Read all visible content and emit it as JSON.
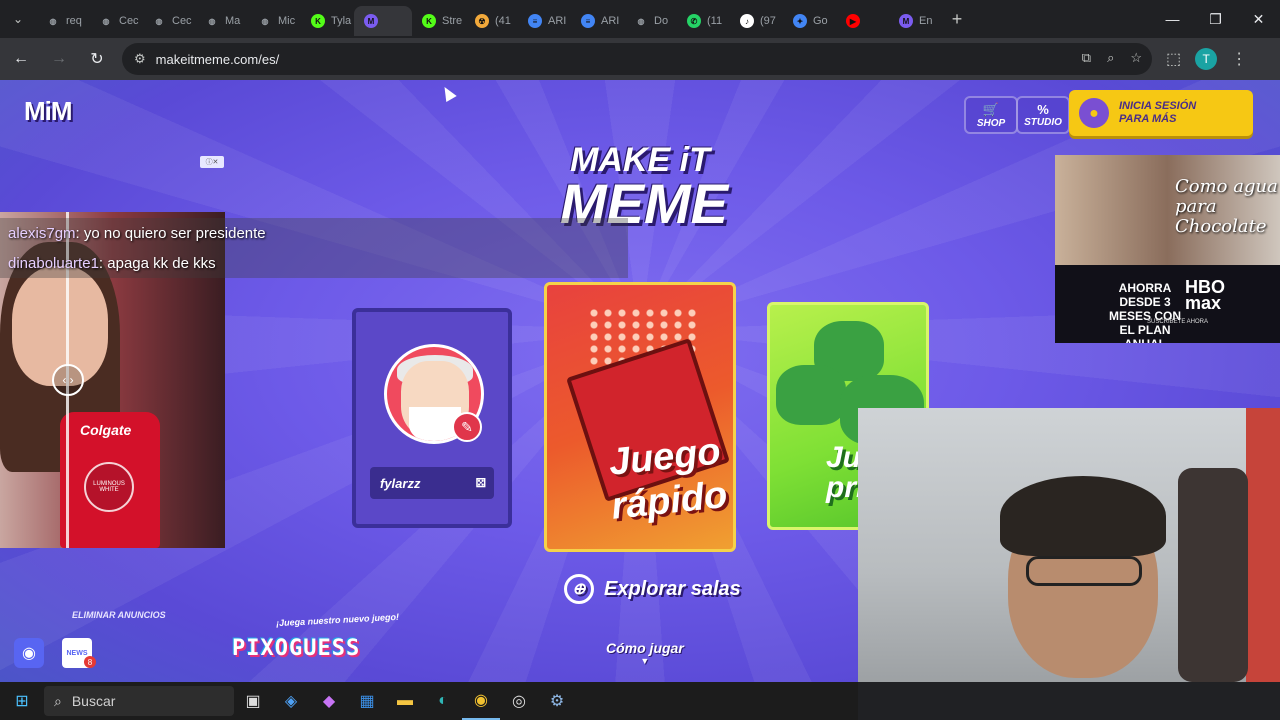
{
  "browser": {
    "tabs": [
      {
        "label": "req",
        "icon": "globe-icon",
        "color": "#9aa0a6"
      },
      {
        "label": "Cec",
        "icon": "globe-icon",
        "color": "#9aa0a6"
      },
      {
        "label": "Cec",
        "icon": "globe-icon",
        "color": "#9aa0a6"
      },
      {
        "label": "Ma",
        "icon": "globe-icon",
        "color": "#9aa0a6"
      },
      {
        "label": "Mic",
        "icon": "globe-icon",
        "color": "#9aa0a6"
      },
      {
        "label": "Tyla",
        "icon": "k-icon",
        "color": "#53fc18"
      },
      {
        "label": "",
        "icon": "mim-icon",
        "color": "#7b5cf0",
        "active": true
      },
      {
        "label": "Stre",
        "icon": "k-icon",
        "color": "#53fc18"
      },
      {
        "label": "(41",
        "icon": "bolt-icon",
        "color": "#f2a93b"
      },
      {
        "label": "ARI",
        "icon": "doc-icon",
        "color": "#4285f4"
      },
      {
        "label": "ARI",
        "icon": "doc-icon",
        "color": "#4285f4"
      },
      {
        "label": "Do",
        "icon": "globe-icon",
        "color": "#9aa0a6"
      },
      {
        "label": "(11",
        "icon": "whatsapp-icon",
        "color": "#25d366"
      },
      {
        "label": "(97",
        "icon": "tiktok-icon",
        "color": "#ffffff"
      },
      {
        "label": "Go",
        "icon": "gemini-icon",
        "color": "#4285f4"
      },
      {
        "label": "",
        "icon": "youtube-icon",
        "color": "#ff0000"
      },
      {
        "label": "En",
        "icon": "mim-icon",
        "color": "#7b5cf0"
      }
    ],
    "url": "makeitmeme.com/es/"
  },
  "site": {
    "logo_small": "MiM",
    "shop_label": "SHOP",
    "studio_label": "STUDIO",
    "login_line1": "INICIA SESIÓN",
    "login_line2": "PARA MÁS",
    "title_line1": "MAKE iT",
    "title_line2": "MEME",
    "profile_nick": "fylarzz",
    "quick_play_line1": "Juego",
    "quick_play_line2": "rápido",
    "private_line1": "Ju",
    "private_line2": "priv",
    "explore_label": "Explorar salas",
    "howto_label": "Cómo jugar",
    "remove_ads_label": "ELIMINAR ANUNCIOS",
    "news_label": "NEWS",
    "news_count": "8",
    "new_game_note": "¡Juega nuestro nuevo juego!",
    "pixoguess": "PIXOGUESS"
  },
  "chat": [
    {
      "user": "alexis7gm",
      "message": ": yo no quiero ser presidente"
    },
    {
      "user": "dinaboluarte1",
      "message": ": apaga kk de kks"
    }
  ],
  "ads": {
    "left_brand": "Colgate",
    "left_product": "LUMINOUS WHITE",
    "right_title": "Como agua para Chocolate",
    "right_offer": "AHORRA DESDE 3 MESES CON EL PLAN ANUAL",
    "right_brand": "HBO max",
    "right_cta": "SUSCRÍBETE AHORA"
  },
  "taskbar": {
    "search_placeholder": "Buscar"
  },
  "colors": {
    "accent_yellow": "#f6c814",
    "bg_purple": "#6d5ae8",
    "quick_red": "#e8423e",
    "private_green": "#7fe035"
  }
}
